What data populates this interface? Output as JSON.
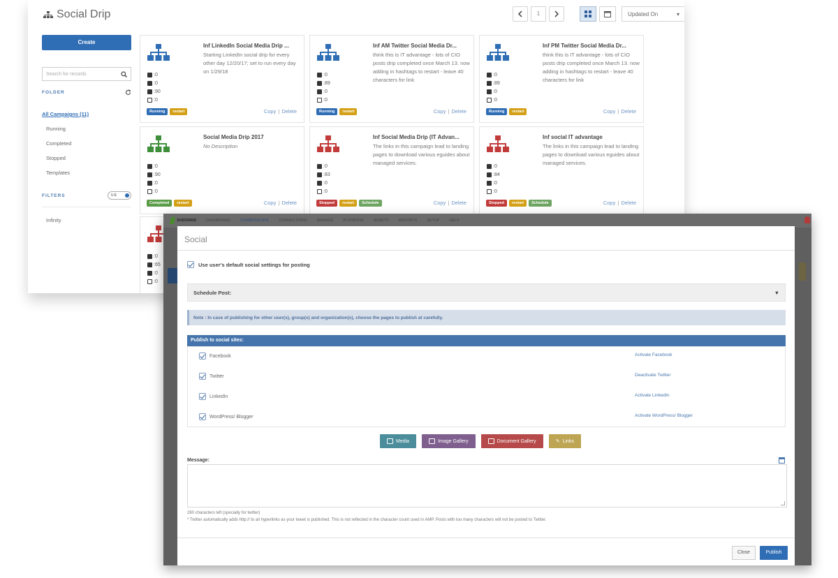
{
  "app": {
    "title": "Social Drip",
    "create_label": "Create",
    "search_placeholder": "Search for records",
    "folder_heading": "FOLDER",
    "all_campaigns": "All Campaigns (11)",
    "folders": [
      "Running",
      "Completed",
      "Stopped",
      "Templates"
    ],
    "filters_heading": "FILTERS",
    "toggle_label": "UE",
    "filter_item": "Infinity",
    "pager_value": "1",
    "sort_value": "Updated On"
  },
  "cards": [
    {
      "title": "Inf LinkedIn Social Media Drip ...",
      "desc": "Starting LinkedIn social drip for every other day 12/20/17; set to run every day on 1/29/18",
      "color": "#2f6db5",
      "stats": [
        ":0",
        ":0",
        ":90",
        ":0"
      ],
      "badges": [
        {
          "label": "Running",
          "type": "running"
        },
        {
          "label": "restart",
          "type": "restart"
        }
      ],
      "copy": "Copy",
      "delete": "Delete"
    },
    {
      "title": "Inf AM Twitter Social Media Dr...",
      "desc": "think this is IT advantage - lots of CIO posts drip completed once March 13. now adding in hashtags to restart - leave 40 characters for link",
      "color": "#2f6db5",
      "stats": [
        ":0",
        ":89",
        ":0",
        ":0"
      ],
      "badges": [
        {
          "label": "Running",
          "type": "running"
        },
        {
          "label": "restart",
          "type": "restart"
        }
      ],
      "copy": "Copy",
      "delete": "Delete"
    },
    {
      "title": "Inf PM Twitter Social Media Dr...",
      "desc": "think this is IT advantage - lots of CIO posts drip completed once March 13. now adding in hashtags to restart - leave 40 characters for link",
      "color": "#2f6db5",
      "stats": [
        ":0",
        ":89",
        ":0",
        ":0"
      ],
      "badges": [
        {
          "label": "Running",
          "type": "running"
        },
        {
          "label": "restart",
          "type": "restart"
        }
      ],
      "copy": "Copy",
      "delete": "Delete"
    },
    {
      "title": "Social Media Drip 2017",
      "desc": "No Description",
      "italic": true,
      "color": "#3f8f3a",
      "stats": [
        ":0",
        ":90",
        ":0",
        ":0"
      ],
      "badges": [
        {
          "label": "Completed",
          "type": "completed"
        },
        {
          "label": "restart",
          "type": "restart"
        }
      ],
      "copy": "Copy",
      "delete": "Delete"
    },
    {
      "title": "Inf Social Media Drip (IT Advan...",
      "desc": "The links in this campaign lead to landing pages to download various eguides about managed services.",
      "color": "#c23b3b",
      "stats": [
        ":0",
        ":83",
        ":0",
        ":0"
      ],
      "badges": [
        {
          "label": "Stopped",
          "type": "stopped"
        },
        {
          "label": "restart",
          "type": "restart"
        },
        {
          "label": "Schedule",
          "type": "schedule"
        }
      ],
      "copy": "Copy",
      "delete": "Delete"
    },
    {
      "title": "Inf social IT advantage",
      "desc": "The links in this campaign lead to landing pages to download various eguides about managed services.",
      "color": "#c23b3b",
      "stats": [
        ":0",
        ":84",
        ":0",
        ":0"
      ],
      "badges": [
        {
          "label": "Stopped",
          "type": "stopped"
        },
        {
          "label": "restart",
          "type": "restart"
        },
        {
          "label": "Schedule",
          "type": "schedule"
        }
      ],
      "copy": "Copy",
      "delete": "Delete"
    }
  ],
  "partial_card": {
    "color": "#c23b3b",
    "stats": [
      ":0",
      ":65",
      ":0",
      ":0"
    ]
  },
  "front_nav": {
    "brand": "SHERWEB",
    "items": [
      "DASHBOARD",
      "COMMUNICATE",
      "CONNECTIONS",
      "MANAGE",
      "PLAYBOOK",
      "ASSETS",
      "REPORTS",
      "SETUP",
      "HELP"
    ],
    "active_index": 1
  },
  "modal": {
    "title": "Social",
    "default_settings_label": "Use user's default social settings for posting",
    "schedule_label": "Schedule Post:",
    "note": "Note : In case of publishing for other user(s), group(s) and organization(s), choose the pages to publish at carefully.",
    "publish_heading": "Publish to social sites:",
    "sites": [
      {
        "name": "Facebook",
        "action": "Activate Facebook"
      },
      {
        "name": "Twitter",
        "action": "Deactivate Twitter"
      },
      {
        "name": "LinkedIn",
        "action": "Activate LinkedIn"
      },
      {
        "name": "WordPress/ Blogger",
        "action": "Activate WordPress/ Blogger"
      }
    ],
    "buttons": {
      "media": "Media",
      "image_gallery": "Image Gallery",
      "document_gallery": "Document Gallery",
      "links": "Links"
    },
    "message_label": "Message:",
    "chars_left": "280 characters left (specially for twitter)",
    "twitter_note": "* Twitter automatically adds http:// to all hyperlinks as your tweet is published. This is not reflected in the character count used in AMP. Posts with too many characters will not be posted to Twitter.",
    "close_label": "Close",
    "publish_label": "Publish"
  }
}
